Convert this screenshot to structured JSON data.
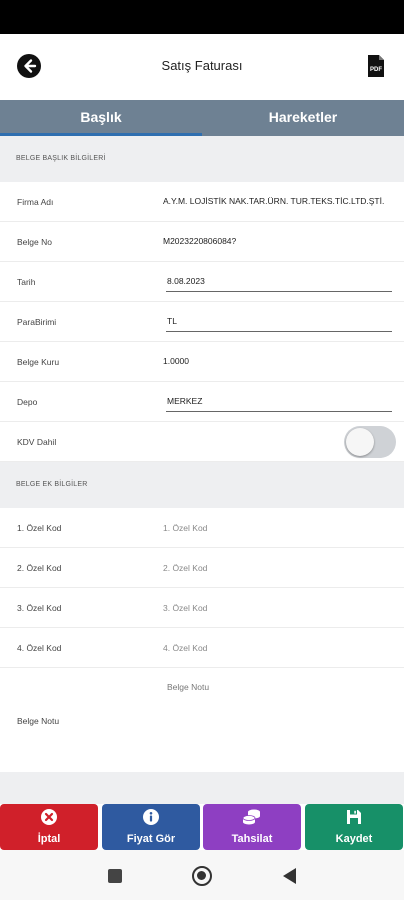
{
  "header": {
    "title": "Satış Faturası",
    "back_icon": "arrow-left-icon",
    "pdf_icon": "pdf-icon",
    "pdf_text": "PDF"
  },
  "tabs": [
    {
      "label": "Başlık",
      "active": true
    },
    {
      "label": "Hareketler",
      "active": false
    }
  ],
  "section_header": {
    "title": "BELGE BAŞLIK BİLGİLERİ",
    "fields": {
      "firma_adi": {
        "label": "Firma Adı",
        "value": "A.Y.M. LOJİSTİK NAK.TAR.ÜRN. TUR.TEKS.TİC.LTD.ŞTİ."
      },
      "belge_no": {
        "label": "Belge No",
        "value": "M2023220806084?"
      },
      "tarih": {
        "label": "Tarih",
        "value": "8.08.2023"
      },
      "para_birimi": {
        "label": "ParaBirimi",
        "value": "TL"
      },
      "belge_kuru": {
        "label": "Belge Kuru",
        "value": "1.0000"
      },
      "depo": {
        "label": "Depo",
        "value": "MERKEZ"
      },
      "kdv_dahil": {
        "label": "KDV Dahil",
        "checked": false
      }
    }
  },
  "section_extra": {
    "title": "BELGE EK BİLGİLER",
    "fields": {
      "ozel_kod_1": {
        "label": "1. Özel Kod",
        "placeholder": "1. Özel Kod"
      },
      "ozel_kod_2": {
        "label": "2. Özel Kod",
        "placeholder": "2. Özel Kod"
      },
      "ozel_kod_3": {
        "label": "3. Özel Kod",
        "placeholder": "3. Özel Kod"
      },
      "ozel_kod_4": {
        "label": "4. Özel Kod",
        "placeholder": "4. Özel Kod"
      },
      "belge_notu": {
        "label": "Belge Notu",
        "placeholder": "Belge Notu"
      }
    }
  },
  "actions": [
    {
      "label": "İptal",
      "icon": "close-circle-icon",
      "color": "#d0202a"
    },
    {
      "label": "Fiyat Gör",
      "icon": "info-circle-icon",
      "color": "#2f5aa0"
    },
    {
      "label": "Tahsilat",
      "icon": "coins-icon",
      "color": "#8e3fc2"
    },
    {
      "label": "Kaydet",
      "icon": "save-icon",
      "color": "#179068"
    }
  ]
}
